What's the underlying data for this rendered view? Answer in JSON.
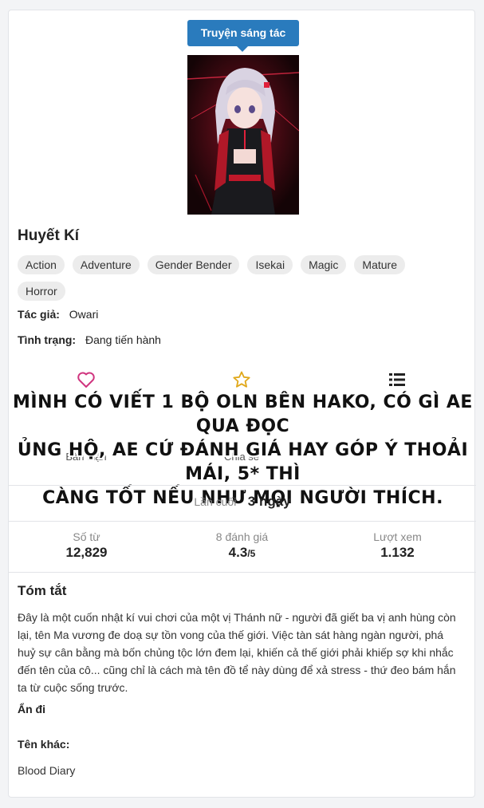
{
  "badge": "Truyện sáng tác",
  "title": "Huyết Kí",
  "tags": [
    "Action",
    "Adventure",
    "Gender Bender",
    "Isekai",
    "Magic",
    "Mature",
    "Horror"
  ],
  "author": {
    "label": "Tác giả:",
    "value": "Owari"
  },
  "status": {
    "label": "Tình trạng:",
    "value": "Đang tiến hành"
  },
  "actions": [
    {
      "icon": "heart-icon",
      "label": "Bàn luận"
    },
    {
      "icon": "star-icon",
      "label": "Chia sẻ"
    },
    {
      "icon": "list-icon",
      "label": ""
    }
  ],
  "overlay_lines": [
    "MÌNH CÓ VIẾT 1 BỘ OLN BÊN HAKO, CÓ GÌ AE QUA ĐỌC",
    "ỦNG HỘ, AE CỨ ĐÁNH GIÁ HAY GÓP Ý THOẢI MÁI, 5* THÌ",
    "CÀNG TỐT NẾU NHƯ MỌI NGƯỜI THÍCH."
  ],
  "last_update": {
    "label": "Lần cuối",
    "value": "3 ngày"
  },
  "stats": [
    {
      "label": "Số từ",
      "value": "12,829",
      "suffix": ""
    },
    {
      "label": "8 đánh giá",
      "value": "4.3",
      "suffix": "/5"
    },
    {
      "label": "Lượt xem",
      "value": "1.132",
      "suffix": ""
    }
  ],
  "summary": {
    "heading": "Tóm tắt",
    "text": "Đây là một cuốn nhật kí vui chơi của một vị Thánh nữ - người đã giết ba vị anh hùng còn lại, tên Ma vương đe doạ sự tồn vong của thế giới. Việc tàn sát hàng ngàn người, phá huỷ sự cân bằng mà bốn chủng tộc lớn đem lại, khiến cả thế giới phải khiếp sợ khi nhắc đến tên của cô... cũng chỉ là cách mà tên đồ tể này dùng để xả stress - thứ đeo bám hắn ta từ cuộc sống trước.",
    "hide_label": "Ẩn đi"
  },
  "other_names": {
    "label": "Tên khác:",
    "value": "Blood Diary"
  },
  "colors": {
    "badge": "#2a7bbd",
    "heart": "#d0357f",
    "star": "#e0a81a",
    "list": "#222222"
  }
}
